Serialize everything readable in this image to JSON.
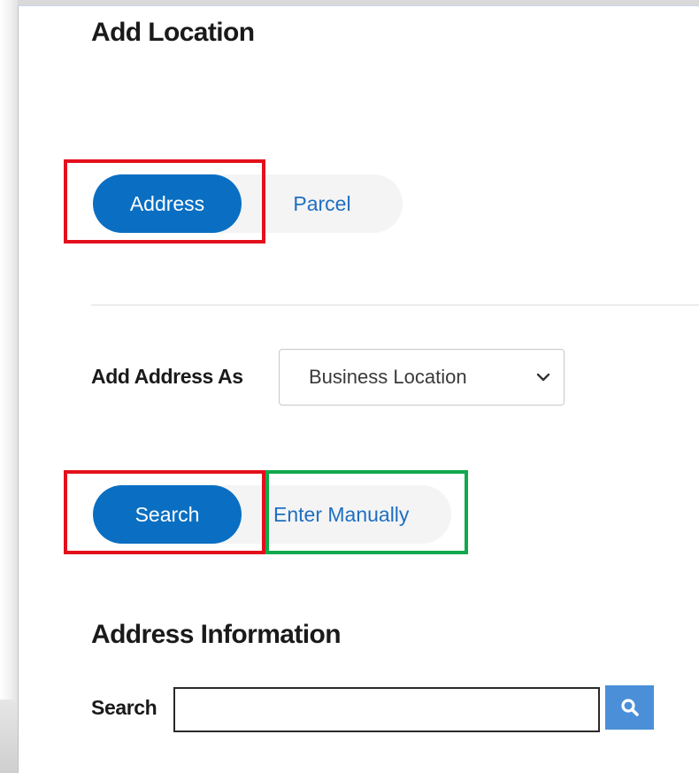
{
  "page": {
    "title": "Add Location"
  },
  "location_type": {
    "options": [
      "Address",
      "Parcel"
    ],
    "selected": "Address"
  },
  "add_address_as": {
    "label": "Add Address As",
    "value": "Business Location"
  },
  "entry_mode": {
    "options": [
      "Search",
      "Enter Manually"
    ],
    "selected": "Search"
  },
  "address_information": {
    "title": "Address Information",
    "search_label": "Search",
    "search_value": ""
  },
  "icons": {
    "select": "chevron-down-icon",
    "search": "search-icon"
  },
  "colors": {
    "accent": "#0a6fc2",
    "link": "#1f6fc0",
    "highlight_red": "#e3101c",
    "highlight_green": "#10a94c",
    "search_button": "#4a8fd8"
  }
}
